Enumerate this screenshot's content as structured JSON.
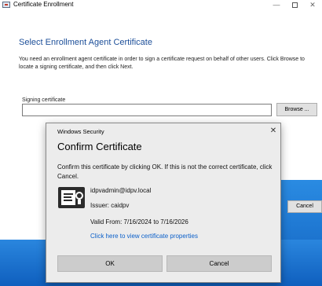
{
  "wizard": {
    "title": "Certificate Enrollment",
    "heading": "Select Enrollment Agent Certificate",
    "description": "You need an enrollment agent certificate in order to sign a certificate request on behalf of other users. Click Browse to locate a signing certificate, and then click Next.",
    "signing_label": "Signing certificate",
    "signing_value": "",
    "browse_label": "Browse ...",
    "cancel_label": "Cancel"
  },
  "dialog": {
    "title": "Windows Security",
    "heading": "Confirm Certificate",
    "text": "Confirm this certificate by clicking OK. If this is not the correct certificate, click Cancel.",
    "cert_subject": "idpvadmin@idpv.local",
    "cert_issuer": "Issuer: caidpv",
    "cert_valid": "Valid From: 7/16/2024 to 7/16/2026",
    "cert_link": "Click here to view certificate properties",
    "ok_label": "OK",
    "cancel_label": "Cancel",
    "close_glyph": "✕"
  },
  "window_controls": {
    "minimize_glyph": "—",
    "close_glyph": "✕"
  },
  "icons": {
    "app": "certificate-app-icon",
    "certificate": "certificate-icon"
  },
  "colors": {
    "heading_blue": "#1d4f99",
    "link_blue": "#0a5fc9",
    "desktop_blue": "#1677d4"
  }
}
